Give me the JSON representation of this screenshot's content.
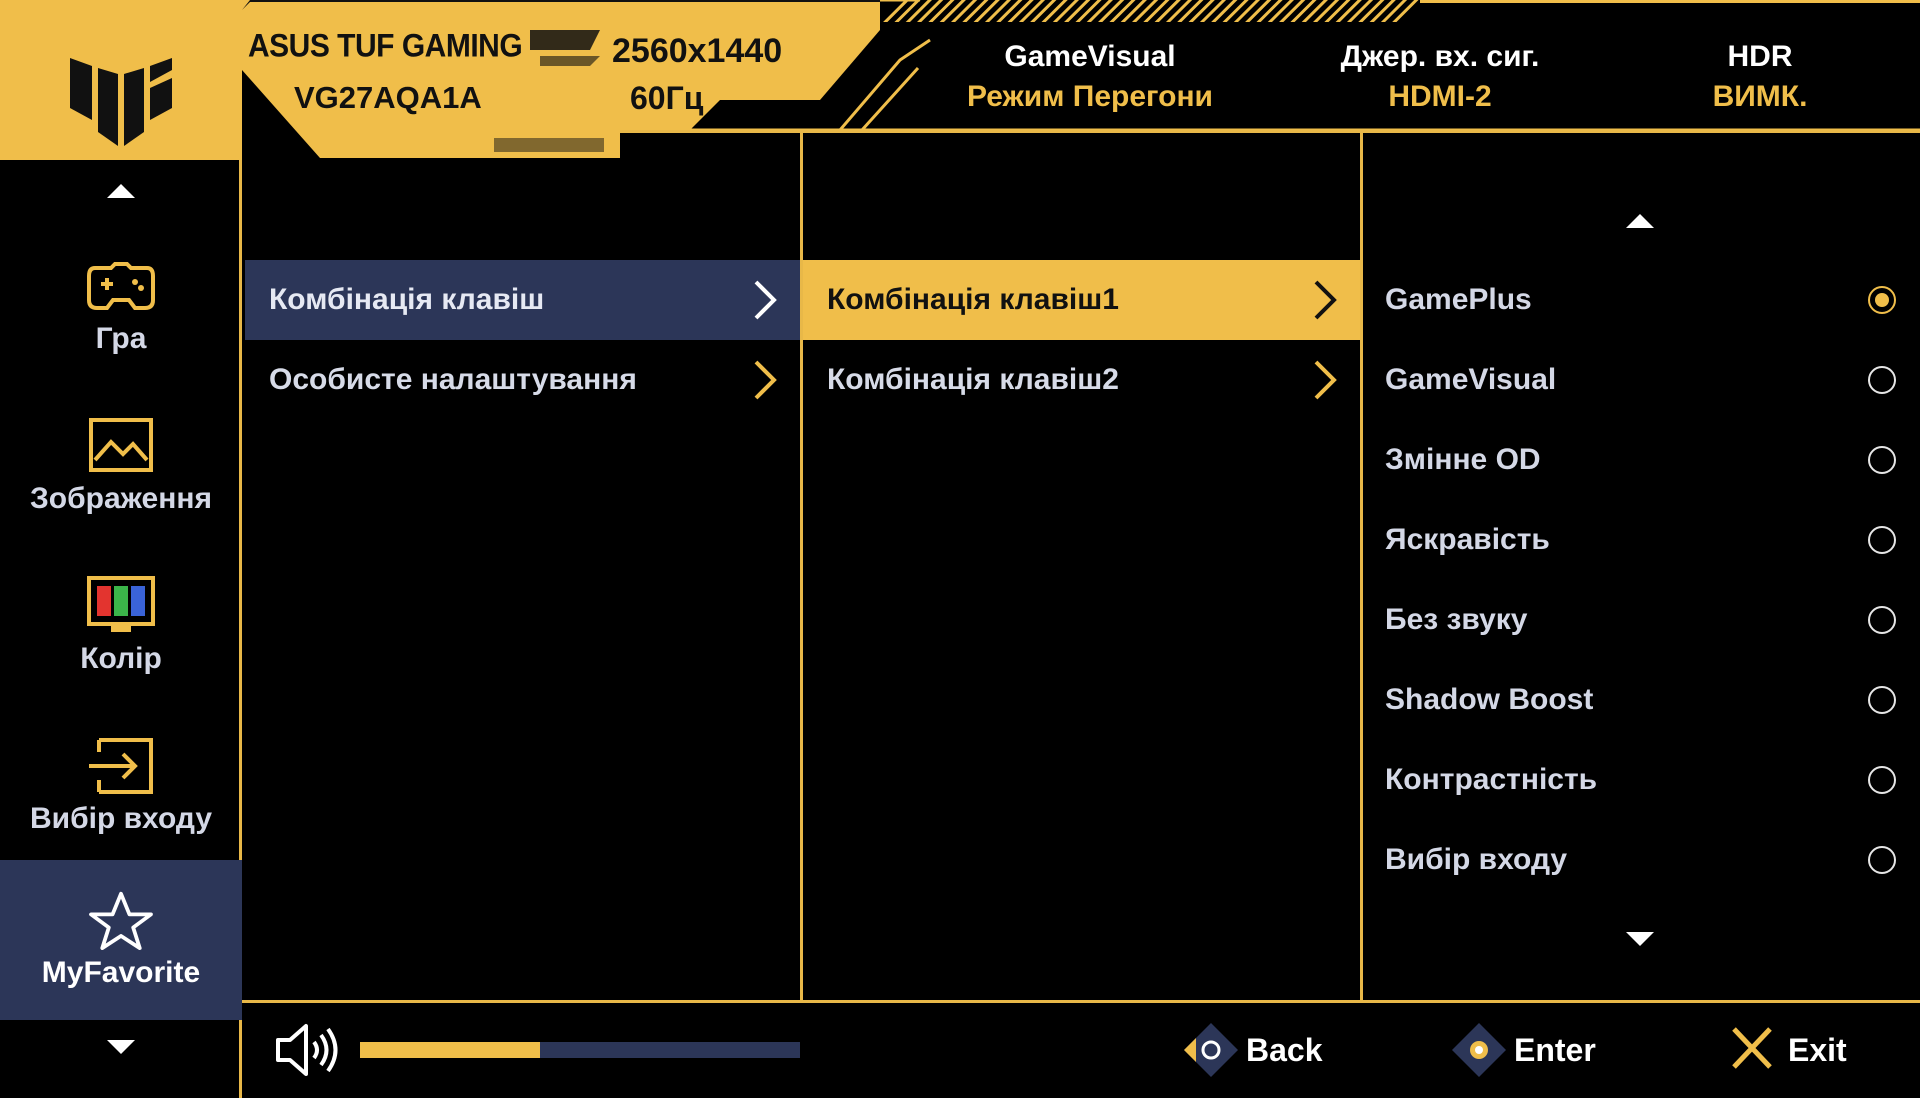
{
  "header": {
    "brand": "ASUS TUF GAMING",
    "model": "VG27AQA1A",
    "resolution": "2560x1440",
    "refresh": "60Гц",
    "status": [
      {
        "label": "GameVisual",
        "value": "Режим Перегони"
      },
      {
        "label": "Джер. вх. сиг.",
        "value": "HDMI-2"
      },
      {
        "label": "HDR",
        "value": "ВИМК."
      }
    ]
  },
  "sidebar": {
    "items": [
      {
        "label": "Гра",
        "icon": "gamepad-icon"
      },
      {
        "label": "Зображення",
        "icon": "image-icon"
      },
      {
        "label": "Колір",
        "icon": "color-icon"
      },
      {
        "label": "Вибір входу",
        "icon": "input-icon"
      },
      {
        "label": "MyFavorite",
        "icon": "star-icon"
      }
    ],
    "active": "MyFavorite"
  },
  "column1": {
    "items": [
      {
        "label": "Комбінація клавіш"
      },
      {
        "label": "Особисте налаштування"
      }
    ],
    "selected": "Комбінація клавіш"
  },
  "column2": {
    "items": [
      {
        "label": "Комбінація клавіш1"
      },
      {
        "label": "Комбінація клавіш2"
      }
    ],
    "selected": "Комбінація клавіш1"
  },
  "column3": {
    "options": [
      {
        "label": "GamePlus",
        "checked": true
      },
      {
        "label": "GameVisual",
        "checked": false
      },
      {
        "label": "Змінне OD",
        "checked": false
      },
      {
        "label": "Яскравість",
        "checked": false
      },
      {
        "label": "Без звуку",
        "checked": false
      },
      {
        "label": "Shadow Boost",
        "checked": false
      },
      {
        "label": "Контрастність",
        "checked": false
      },
      {
        "label": "Вибір входу",
        "checked": false
      }
    ]
  },
  "footer": {
    "volume_level": 0.41,
    "back_label": "Back",
    "enter_label": "Enter",
    "exit_label": "Exit"
  },
  "colors": {
    "accent": "#f0be4a",
    "selection_navy": "#2c3658",
    "background": "#000000"
  }
}
